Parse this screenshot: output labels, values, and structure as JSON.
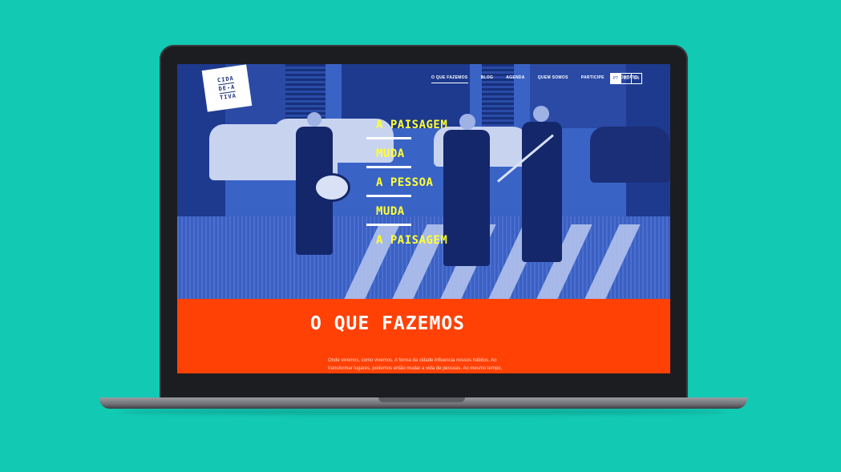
{
  "brand": {
    "logo_lines": [
      "CIDA",
      "DE-A",
      "TIVA"
    ]
  },
  "nav": {
    "items": [
      "O QUE FAZEMOS",
      "BLOG",
      "AGENDA",
      "QUEM SOMOS",
      "PARTICIPE",
      "CONTATO"
    ],
    "active_index": 0
  },
  "languages": {
    "items": [
      "PT",
      "ES",
      "EN"
    ],
    "active_index": 0
  },
  "hero": {
    "slogan": [
      "A PAISAGEM",
      "MUDA",
      "A PESSOA",
      "MUDA",
      "A PAISAGEM"
    ]
  },
  "section": {
    "title": "O QUE FAZEMOS",
    "body": "Onde vivemos, como vivemos. A forma da cidade influencia nossos hábitos. Ao transformar lugares, podemos então mudar a vida de pessoas. Ao mesmo tempo,"
  },
  "colors": {
    "background": "#12c9b3",
    "hero_tint": "#3a63c6",
    "accent_yellow": "#ffff33",
    "section_orange": "#ff4106"
  },
  "icons": [
    "laptop-frame"
  ]
}
